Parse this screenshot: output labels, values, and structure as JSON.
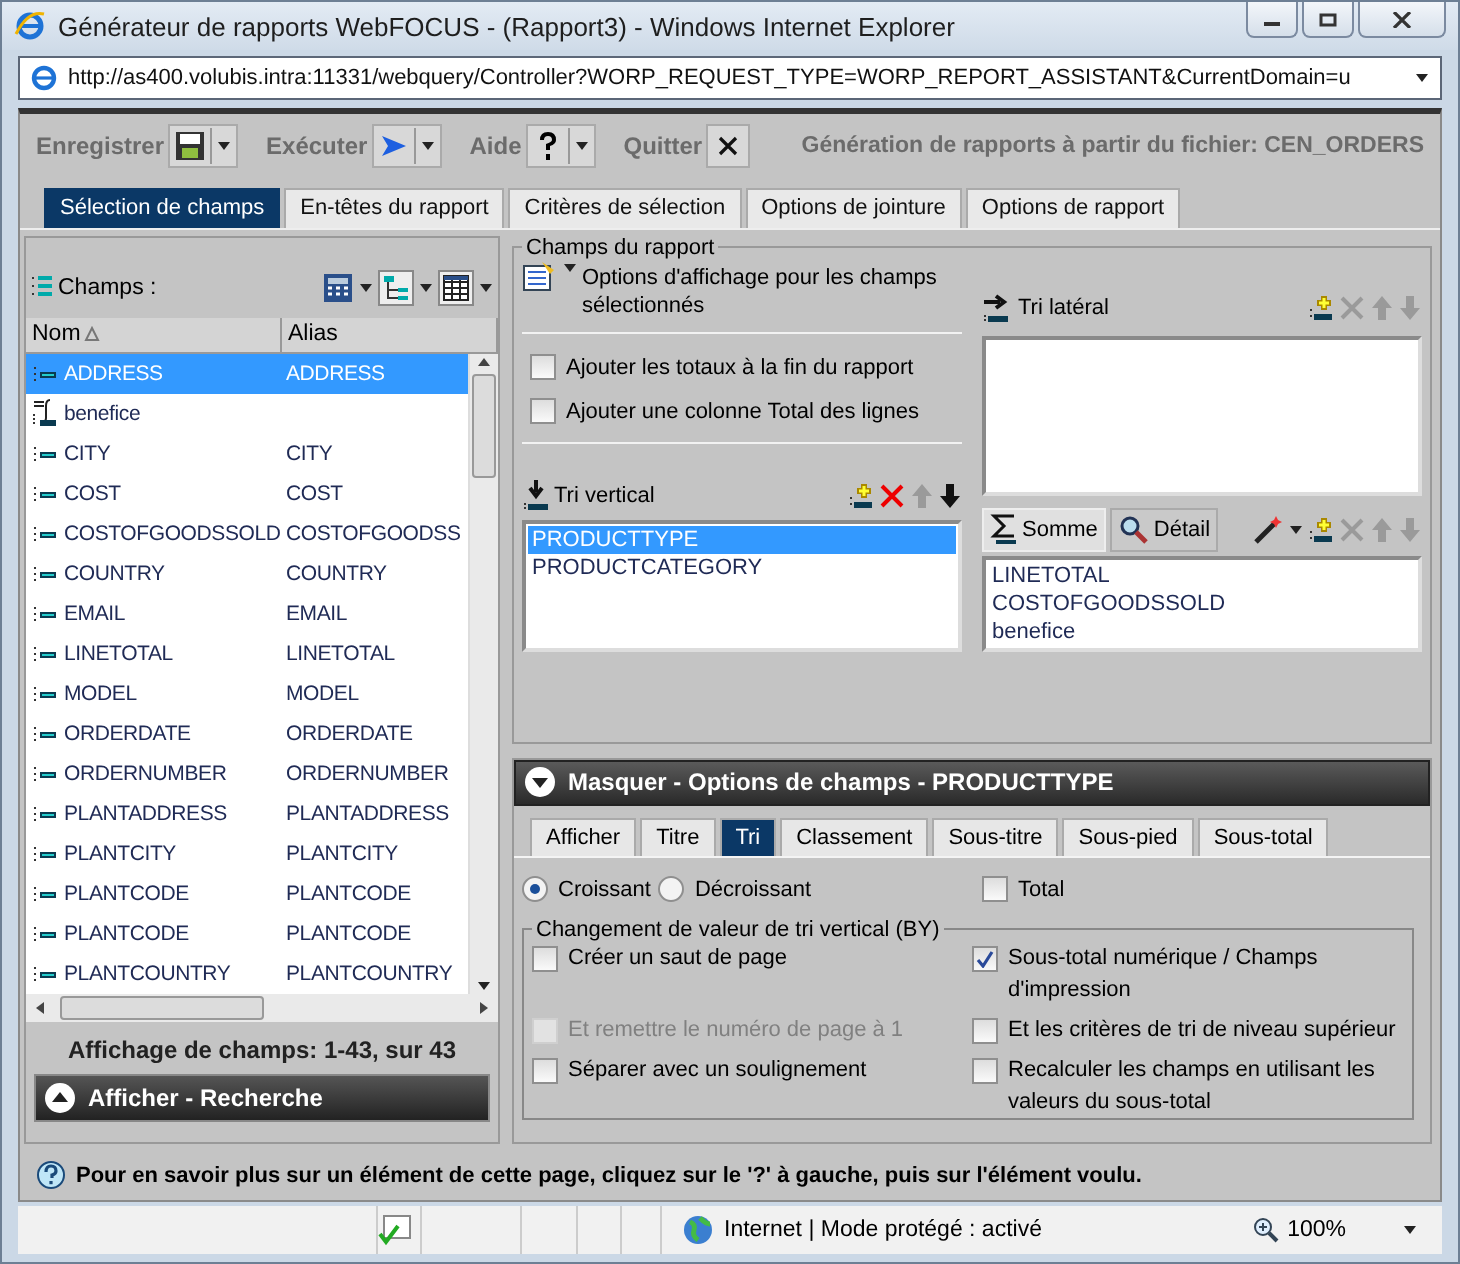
{
  "window": {
    "title": "Générateur de rapports WebFOCUS - (Rapport3) - Windows Internet Explorer"
  },
  "address_bar": {
    "url": "http://as400.volubis.intra:11331/webquery/Controller?WORP_REQUEST_TYPE=WORP_REPORT_ASSISTANT&CurrentDomain=u"
  },
  "toolbar": {
    "items": [
      {
        "label": "Enregistrer",
        "kind": "save"
      },
      {
        "label": "Exécuter",
        "kind": "run"
      },
      {
        "label": "Aide",
        "kind": "help"
      },
      {
        "label": "Quitter",
        "kind": "quit"
      }
    ],
    "caption": "Génération de rapports à partir du fichier: CEN_ORDERS"
  },
  "tabs": [
    {
      "label": "Sélection de champs",
      "selected": true
    },
    {
      "label": "En-têtes du rapport",
      "selected": false
    },
    {
      "label": "Critères de sélection",
      "selected": false
    },
    {
      "label": "Options de jointure",
      "selected": false
    },
    {
      "label": "Options de rapport",
      "selected": false
    }
  ],
  "fields_panel": {
    "label": "Champs :",
    "columns": [
      "Nom",
      "Alias"
    ],
    "rows": [
      {
        "name": "ADDRESS",
        "alias": "ADDRESS",
        "kind": "field",
        "selected": true
      },
      {
        "name": "benefice",
        "kind": "computed",
        "selected": false
      },
      {
        "name": "CITY",
        "alias": "CITY",
        "kind": "field",
        "selected": false
      },
      {
        "name": "COST",
        "alias": "COST",
        "kind": "field",
        "selected": false
      },
      {
        "name": "COSTOFGOODSSOLD",
        "alias": "COSTOFGOODSS",
        "kind": "field",
        "selected": false
      },
      {
        "name": "COUNTRY",
        "alias": "COUNTRY",
        "kind": "field",
        "selected": false
      },
      {
        "name": "EMAIL",
        "alias": "EMAIL",
        "kind": "field",
        "selected": false
      },
      {
        "name": "LINETOTAL",
        "alias": "LINETOTAL",
        "kind": "field",
        "selected": false
      },
      {
        "name": "MODEL",
        "alias": "MODEL",
        "kind": "field",
        "selected": false
      },
      {
        "name": "ORDERDATE",
        "alias": "ORDERDATE",
        "kind": "field",
        "selected": false
      },
      {
        "name": "ORDERNUMBER",
        "alias": "ORDERNUMBER",
        "kind": "field",
        "selected": false
      },
      {
        "name": "PLANTADDRESS",
        "alias": "PLANTADDRESS",
        "kind": "field",
        "selected": false
      },
      {
        "name": "PLANTCITY",
        "alias": "PLANTCITY",
        "kind": "field",
        "selected": false
      },
      {
        "name": "PLANTCODE",
        "alias": "PLANTCODE",
        "kind": "field",
        "selected": false
      },
      {
        "name": "PLANTCODE",
        "alias": "PLANTCODE",
        "kind": "field",
        "selected": false
      },
      {
        "name": "PLANTCOUNTRY",
        "alias": "PLANTCOUNTRY",
        "kind": "field",
        "selected": false
      }
    ],
    "count": "Affichage de champs: 1-43, sur 43",
    "search_bar": "Afficher - Recherche"
  },
  "report_fields": {
    "title": "Champs du rapport",
    "display_options": "Options d'affichage pour les champs sélectionnés",
    "checkboxes": [
      {
        "label": "Ajouter les totaux à la fin du rapport",
        "checked": false
      },
      {
        "label": "Ajouter une colonne Total des lignes",
        "checked": false
      }
    ],
    "vertical_sort": {
      "label": "Tri vertical",
      "items": [
        {
          "text": "PRODUCTTYPE",
          "selected": true
        },
        {
          "text": "PRODUCTCATEGORY",
          "selected": false
        }
      ]
    },
    "horizontal_sort": {
      "label": "Tri latéral"
    },
    "measure_modes": [
      {
        "label": "Somme",
        "selected": true
      },
      {
        "label": "Détail",
        "selected": false
      }
    ],
    "measures": [
      {
        "text": "LINETOTAL",
        "selected": false
      },
      {
        "text": "COSTOFGOODSSOLD",
        "selected": false
      },
      {
        "text": "benefice",
        "selected": false
      }
    ]
  },
  "field_options": {
    "title": "Masquer - Options de champs - PRODUCTTYPE",
    "tabs": [
      {
        "label": "Afficher",
        "selected": false
      },
      {
        "label": "Titre",
        "selected": false
      },
      {
        "label": "Tri",
        "selected": true
      },
      {
        "label": "Classement",
        "selected": false
      },
      {
        "label": "Sous-titre",
        "selected": false
      },
      {
        "label": "Sous-pied",
        "selected": false
      },
      {
        "label": "Sous-total",
        "selected": false
      }
    ],
    "order": [
      {
        "label": "Croissant",
        "selected": true
      },
      {
        "label": "Décroissant",
        "selected": false
      }
    ],
    "total": {
      "label": "Total",
      "checked": false
    },
    "group": {
      "title": "Changement de valeur de tri vertical (BY)",
      "options": [
        {
          "label": "Créer un saut de page",
          "checked": false,
          "disabled": false
        },
        {
          "label": "Sous-total numérique / Champs d'impression",
          "checked": true,
          "disabled": false
        },
        {
          "label": "Et remettre le numéro de page à 1",
          "checked": false,
          "disabled": true
        },
        {
          "label": "Et les critères de tri de niveau supérieur",
          "checked": false,
          "disabled": false
        },
        {
          "label": "Séparer avec un soulignement",
          "checked": false,
          "disabled": false
        },
        {
          "label": "Recalculer les champs en utilisant les valeurs du sous-total",
          "checked": false,
          "disabled": false
        }
      ]
    }
  },
  "help_text": "Pour en savoir plus sur un élément de cette page, cliquez sur le '?' à gauche, puis sur l'élément voulu.",
  "status_bar": {
    "zone": "Internet | Mode protégé : activé",
    "zoom": "100%"
  }
}
